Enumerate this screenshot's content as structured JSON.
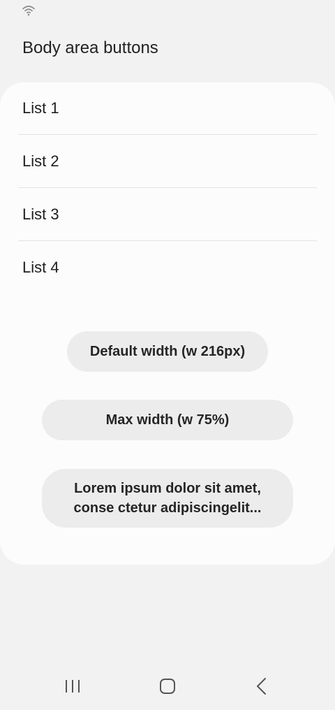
{
  "header": {
    "title": "Body area buttons"
  },
  "list": {
    "items": [
      {
        "label": "List 1"
      },
      {
        "label": "List 2"
      },
      {
        "label": "List 3"
      },
      {
        "label": "List 4"
      }
    ]
  },
  "buttons": {
    "default_label": "Default width (w 216px)",
    "max_label": "Max width (w 75%)",
    "long_label": "Lorem ipsum dolor sit amet, conse ctetur adipiscingelit..."
  },
  "icons": {
    "status": "wifi-icon",
    "recents": "recents-icon",
    "home": "home-icon",
    "back": "back-icon"
  },
  "colors": {
    "background": "#f2f2f2",
    "card": "#fcfcfc",
    "button": "#ececec",
    "divider": "#e3e3e3"
  }
}
